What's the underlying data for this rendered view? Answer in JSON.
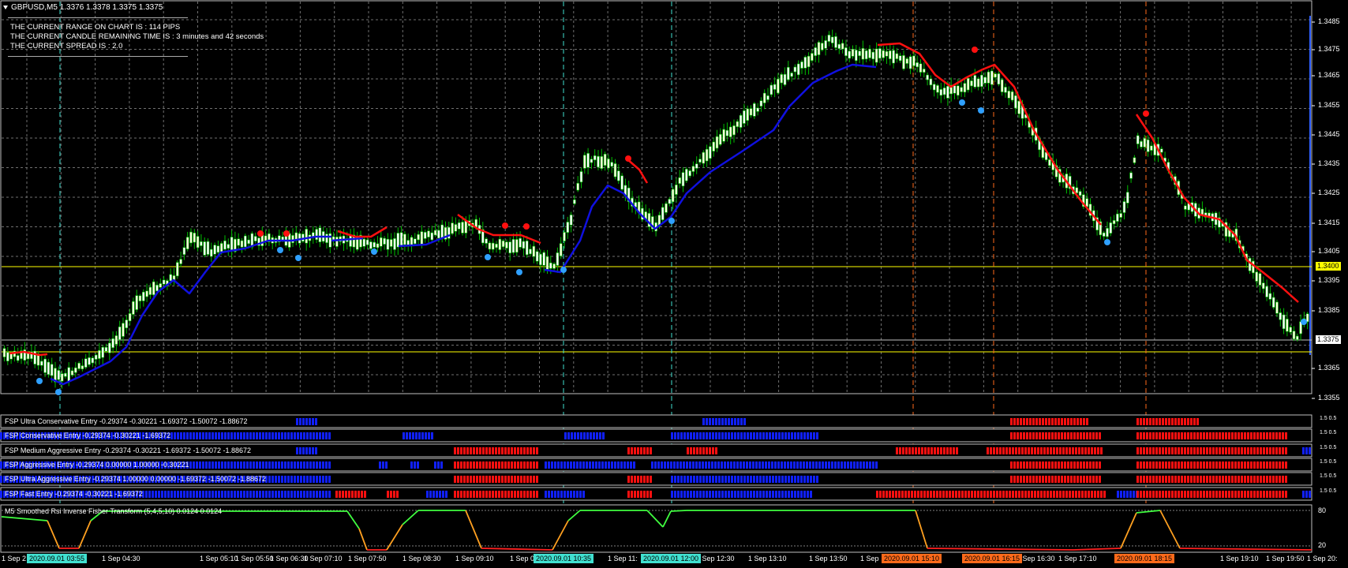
{
  "window": {
    "title": "GBPUSD,M5",
    "ohlc": "1.3376 1.3378 1.3375 1.3375"
  },
  "info": {
    "range": "THE CURRENT RANGE ON CHART IS : 114 PIPS",
    "remaining": "THE CURRENT CANDLE REMAINING TIME IS : 3 minutes and 42 seconds",
    "spread": "THE CURRENT SPREAD IS : 2.0"
  },
  "price_axis": [
    "1.3485",
    "1.3475",
    "1.3465",
    "1.3455",
    "1.3445",
    "1.3435",
    "1.3425",
    "1.3415",
    "1.3405",
    "1.3395",
    "1.3385",
    "1.3365",
    "1.3355"
  ],
  "price_tags": {
    "resistance": "1.3400",
    "current": "1.3375"
  },
  "indicators": [
    {
      "label": "FSP Ultra Conservative Entry -0.29374 -0.30221 -1.69372 -1.50072 -1.88672",
      "scale": [
        "1.5",
        "0.5"
      ]
    },
    {
      "label": "FSP Conservative Entry -0.29374 -0.30221 -1.69372",
      "scale": [
        "1.5",
        "0.5"
      ]
    },
    {
      "label": "FSP Medium Aggressive Entry -0.29374 -0.30221 -1.69372 -1.50072 -1.88672",
      "scale": [
        "1.5",
        "0.5"
      ]
    },
    {
      "label": "FSP Aggressive Entry -0.29374 0.00000 1.00000 -0.30221",
      "scale": [
        "1.5",
        "0.5"
      ]
    },
    {
      "label": "FSP Ultra Aggressive Entry -0.29374 1.00000 0.00000 -1.69372 -1.50072 -1.88672",
      "scale": [
        "1.5",
        "0.5"
      ]
    },
    {
      "label": "FSP Fast Entry -0.29374 -0.30221 -1.69372",
      "scale": [
        "1.5",
        "0.5"
      ]
    }
  ],
  "oscillator": {
    "label": "M5 Smoothed Rsi Inverse Fisher Transform (5,4,5,10) 0.0124 0.0124",
    "scale": [
      "80",
      "20"
    ]
  },
  "time_axis": [
    "1 Sep 2",
    "1 Sep 04:30",
    "1 Sep 05:10",
    "1 Sep 05:50",
    "1 Sep 06:30",
    "1 Sep 07:10",
    "1 Sep 07:50",
    "1 Sep 08:30",
    "1 Sep 09:10",
    "1 Sep 0",
    "1 Sep 11:",
    "1 Sep 12:30",
    "1 Sep 13:10",
    "1 Sep 13:50",
    "1 Sep",
    "1 Sep 16:30",
    "1 Sep 17:10",
    "1 Sep 17:50",
    "1 Sep 19:10",
    "1 Sep 19:50",
    "1 Sep 20:"
  ],
  "time_tags": [
    {
      "text": "2020.09.01 03:55",
      "color": "#40e0d0"
    },
    {
      "text": "2020.09.01 10:35",
      "color": "#40e0d0"
    },
    {
      "text": "2020.09.01 12:00",
      "color": "#40e0d0"
    },
    {
      "text": "2020.09.01 15:10",
      "color": "#ff6a1a"
    },
    {
      "text": "2020.09.01 16:15",
      "color": "#ff6a1a"
    },
    {
      "text": "2020.09.01 18:15",
      "color": "#ff6a1a"
    }
  ],
  "colors": {
    "bull": "#ffffe0",
    "bear": "#ffffff",
    "wick": "#00c000",
    "ma_up": "#1010e0",
    "ma_down": "#ff1010",
    "signal_up": "#2fa0ff",
    "signal_down": "#ff1010",
    "support": "#ffff00",
    "cyan_vline": "#40e0d0",
    "orange_vline": "#ff6a1a"
  }
}
